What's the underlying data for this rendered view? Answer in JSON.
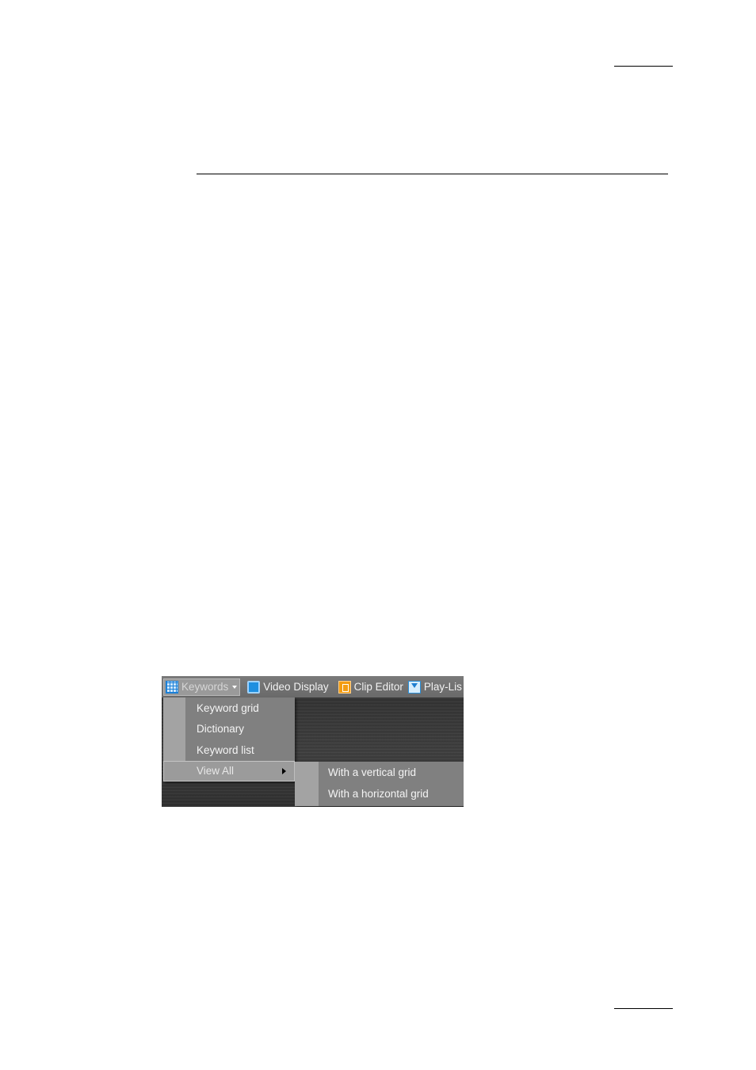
{
  "figure": {
    "toolbar": {
      "keywords_label": "Keywords",
      "video_display_label": "Video Display",
      "clip_editor_label": "Clip Editor",
      "playlist_label": "Play-Lis"
    },
    "keywords_menu": {
      "items": [
        {
          "label": "Keyword grid"
        },
        {
          "label": "Dictionary"
        },
        {
          "label": "Keyword list"
        },
        {
          "label": "View All"
        }
      ]
    },
    "view_all_submenu": {
      "items": [
        {
          "label": "With a vertical grid"
        },
        {
          "label": "With a horizontal grid"
        }
      ]
    }
  }
}
